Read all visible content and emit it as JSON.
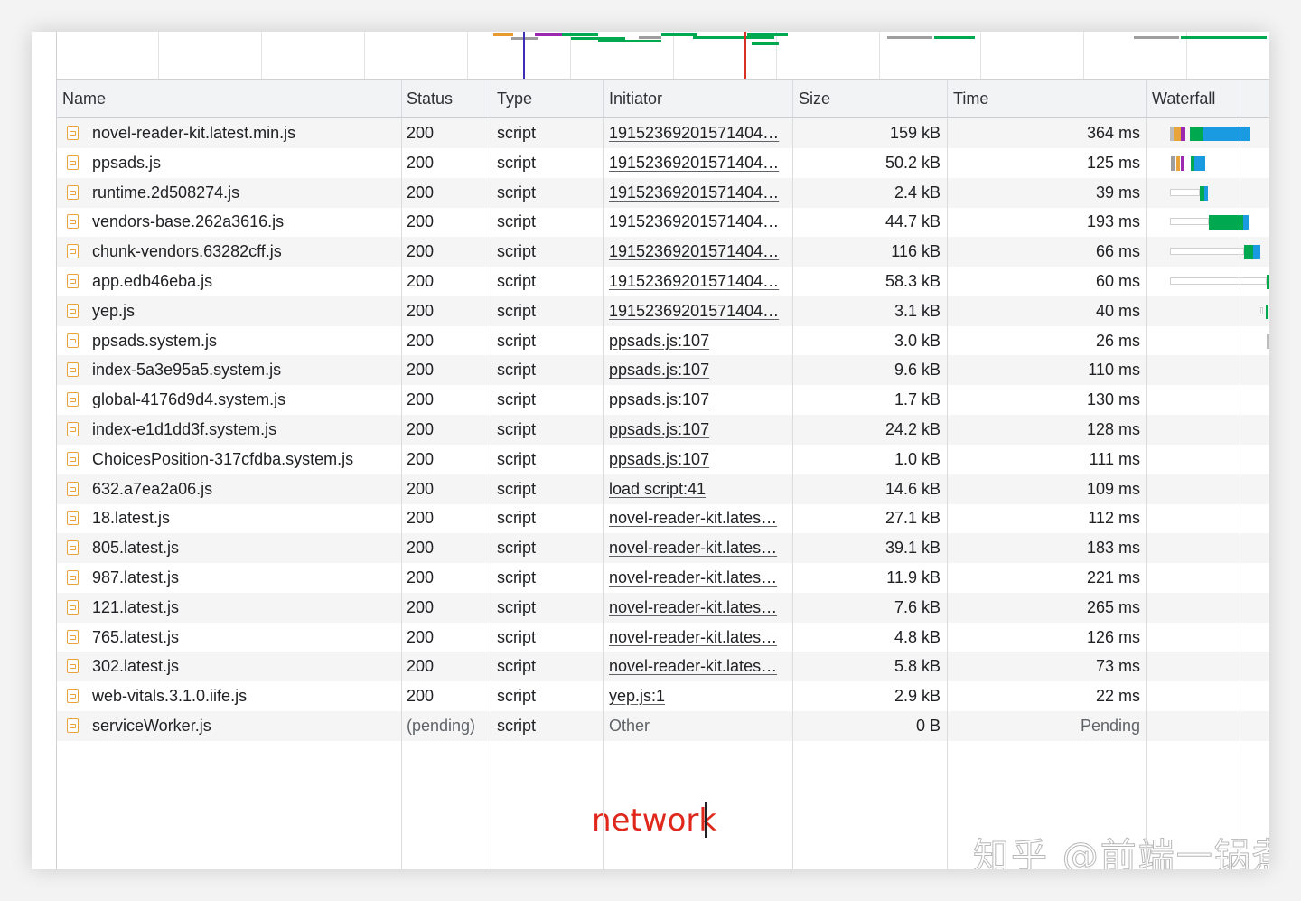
{
  "columns": {
    "name": "Name",
    "status": "Status",
    "type": "Type",
    "initiator": "Initiator",
    "size": "Size",
    "time": "Time",
    "waterfall": "Waterfall"
  },
  "rows": [
    {
      "name": "novel-reader-kit.latest.min.js",
      "status": "200",
      "type": "script",
      "initiator": "19152369201571404…",
      "size": "159 kB",
      "time": "364 ms"
    },
    {
      "name": "ppsads.js",
      "status": "200",
      "type": "script",
      "initiator": "19152369201571404…",
      "size": "50.2 kB",
      "time": "125 ms"
    },
    {
      "name": "runtime.2d508274.js",
      "status": "200",
      "type": "script",
      "initiator": "19152369201571404…",
      "size": "2.4 kB",
      "time": "39 ms"
    },
    {
      "name": "vendors-base.262a3616.js",
      "status": "200",
      "type": "script",
      "initiator": "19152369201571404…",
      "size": "44.7 kB",
      "time": "193 ms"
    },
    {
      "name": "chunk-vendors.63282cff.js",
      "status": "200",
      "type": "script",
      "initiator": "19152369201571404…",
      "size": "116 kB",
      "time": "66 ms"
    },
    {
      "name": "app.edb46eba.js",
      "status": "200",
      "type": "script",
      "initiator": "19152369201571404…",
      "size": "58.3 kB",
      "time": "60 ms"
    },
    {
      "name": "yep.js",
      "status": "200",
      "type": "script",
      "initiator": "19152369201571404…",
      "size": "3.1 kB",
      "time": "40 ms"
    },
    {
      "name": "ppsads.system.js",
      "status": "200",
      "type": "script",
      "initiator": "ppsads.js:107",
      "size": "3.0 kB",
      "time": "26 ms"
    },
    {
      "name": "index-5a3e95a5.system.js",
      "status": "200",
      "type": "script",
      "initiator": "ppsads.js:107",
      "size": "9.6 kB",
      "time": "110 ms"
    },
    {
      "name": "global-4176d9d4.system.js",
      "status": "200",
      "type": "script",
      "initiator": "ppsads.js:107",
      "size": "1.7 kB",
      "time": "130 ms"
    },
    {
      "name": "index-e1d1dd3f.system.js",
      "status": "200",
      "type": "script",
      "initiator": "ppsads.js:107",
      "size": "24.2 kB",
      "time": "128 ms"
    },
    {
      "name": "ChoicesPosition-317cfdba.system.js",
      "status": "200",
      "type": "script",
      "initiator": "ppsads.js:107",
      "size": "1.0 kB",
      "time": "111 ms"
    },
    {
      "name": "632.a7ea2a06.js",
      "status": "200",
      "type": "script",
      "initiator": "load script:41",
      "size": "14.6 kB",
      "time": "109 ms"
    },
    {
      "name": "18.latest.js",
      "status": "200",
      "type": "script",
      "initiator": "novel-reader-kit.lates…",
      "size": "27.1 kB",
      "time": "112 ms"
    },
    {
      "name": "805.latest.js",
      "status": "200",
      "type": "script",
      "initiator": "novel-reader-kit.lates…",
      "size": "39.1 kB",
      "time": "183 ms"
    },
    {
      "name": "987.latest.js",
      "status": "200",
      "type": "script",
      "initiator": "novel-reader-kit.lates…",
      "size": "11.9 kB",
      "time": "221 ms"
    },
    {
      "name": "121.latest.js",
      "status": "200",
      "type": "script",
      "initiator": "novel-reader-kit.lates…",
      "size": "7.6 kB",
      "time": "265 ms"
    },
    {
      "name": "765.latest.js",
      "status": "200",
      "type": "script",
      "initiator": "novel-reader-kit.lates…",
      "size": "4.8 kB",
      "time": "126 ms"
    },
    {
      "name": "302.latest.js",
      "status": "200",
      "type": "script",
      "initiator": "novel-reader-kit.lates…",
      "size": "5.8 kB",
      "time": "73 ms"
    },
    {
      "name": "web-vitals.3.1.0.iife.js",
      "status": "200",
      "type": "script",
      "initiator": "yep.js:1",
      "size": "2.9 kB",
      "time": "22 ms"
    },
    {
      "name": "serviceWorker.js",
      "status": "(pending)",
      "type": "script",
      "initiator": "Other",
      "size": "0 B",
      "time": "Pending",
      "pending": true
    }
  ],
  "annotation": "network",
  "watermark": "知乎 @前端一锅煮",
  "colors": {
    "annotation": "#e0271b",
    "download": "#1a9ae0",
    "waiting": "#00a84f",
    "dom_content_loaded": "#3d2fb5",
    "load": "#d93025",
    "icon": "#e8a33a"
  },
  "icons": {
    "file": "script-file-icon"
  }
}
